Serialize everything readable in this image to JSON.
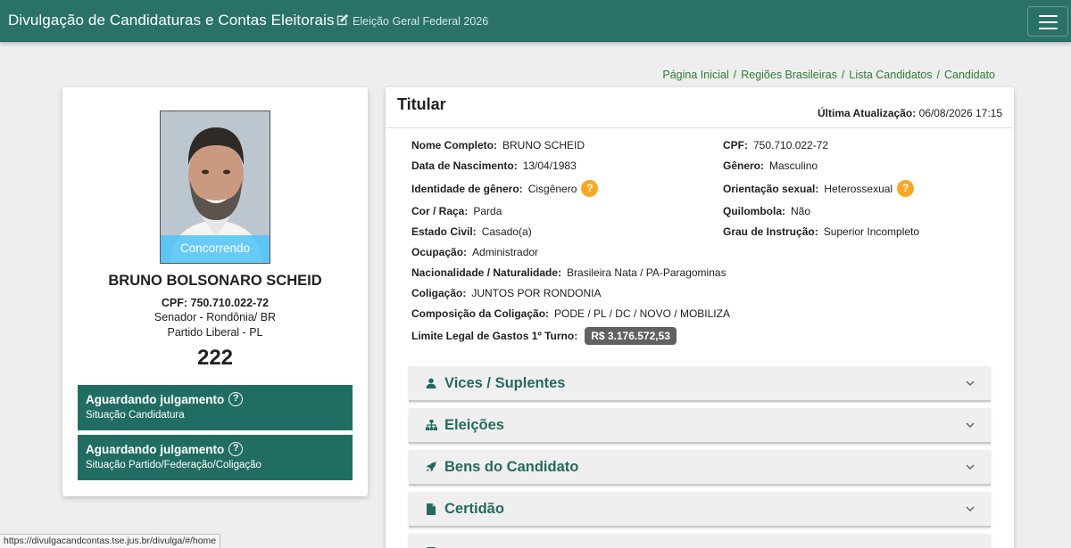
{
  "header": {
    "app_title": "Divulgação de Candidaturas e Contas Eleitorais",
    "election": "Eleição Geral Federal 2026"
  },
  "breadcrumb": [
    "Página Inicial",
    "Regiões Brasileiras",
    "Lista Candidatos",
    "Candidato"
  ],
  "candidate_card": {
    "photo_status": "Concorrendo",
    "name": "BRUNO BOLSONARO SCHEID",
    "cpf": "CPF: 750.710.022-72",
    "office": "Senador - Rondônia/ BR",
    "party": "Partido Liberal - PL",
    "number": "222",
    "status_boxes": [
      {
        "title": "Aguardando julgamento",
        "subtitle": "Situação Candidatura"
      },
      {
        "title": "Aguardando julgamento",
        "subtitle": "Situação Partido/Federação/Coligação"
      }
    ]
  },
  "details": {
    "title": "Titular",
    "update_label": "Última Atualização:",
    "update_value": "06/08/2026 17:15",
    "fields": {
      "nome": {
        "label": "Nome Completo:",
        "value": "BRUNO SCHEID"
      },
      "cpf": {
        "label": "CPF:",
        "value": "750.710.022-72"
      },
      "nascimento": {
        "label": "Data de Nascimento:",
        "value": "13/04/1983"
      },
      "genero": {
        "label": "Gênero:",
        "value": "Masculino"
      },
      "identidade": {
        "label": "Identidade de gênero:",
        "value": "Cisgênero"
      },
      "orientacao": {
        "label": "Orientação sexual:",
        "value": "Heterossexual"
      },
      "cor": {
        "label": "Cor / Raça:",
        "value": "Parda"
      },
      "quilombola": {
        "label": "Quilombola:",
        "value": "Não"
      },
      "estado_civil": {
        "label": "Estado Civil:",
        "value": "Casado(a)"
      },
      "instrucao": {
        "label": "Grau de Instrução:",
        "value": "Superior Incompleto"
      },
      "ocupacao": {
        "label": "Ocupação:",
        "value": "Administrador"
      },
      "nacionalidade": {
        "label": "Nacionalidade / Naturalidade:",
        "value": "Brasileira Nata / PA-Paragominas"
      },
      "coligacao": {
        "label": "Coligação:",
        "value": "JUNTOS POR RONDONIA"
      },
      "composicao": {
        "label": "Composição da Coligação:",
        "value": "PODE / PL / DC / NOVO / MOBILIZA"
      },
      "limite": {
        "label": "Limite Legal de Gastos 1º Turno:",
        "value": "R$ 3.176.572,53"
      }
    },
    "help_glyph": "?"
  },
  "accordions": [
    {
      "label": "Vices / Suplentes",
      "icon": "person-icon"
    },
    {
      "label": "Eleições",
      "icon": "sitemap-icon"
    },
    {
      "label": "Bens do Candidato",
      "icon": "rocket-icon"
    },
    {
      "label": "Certidão",
      "icon": "document-icon"
    }
  ],
  "status_url": "https://divulgacandcontas.tse.jus.br/divulga/#/home",
  "colors": {
    "header": "#2a7269",
    "status_box": "#216d63",
    "accent_text": "#26695f",
    "breadcrumb": "#2e7d32",
    "help_badge": "#f9a825",
    "photo_band": "#4fc3f7"
  }
}
